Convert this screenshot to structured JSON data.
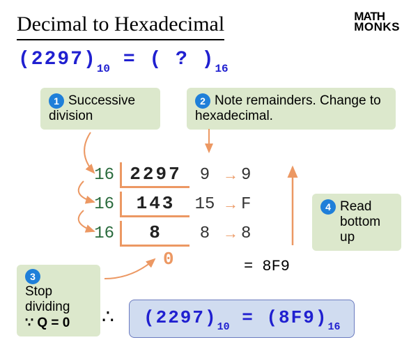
{
  "logo": {
    "line1": "MATH",
    "line2": "MONKS"
  },
  "title": "Decimal to Hexadecimal",
  "eq": {
    "lhs": "(2297)",
    "lbase": "10",
    "mid": " = (   ?   )",
    "rbase": "16"
  },
  "steps": {
    "s1": {
      "num": "1",
      "text": "Successive division"
    },
    "s2": {
      "num": "2",
      "text": "Note remainders. Change to hexadecimal."
    },
    "s3": {
      "num": "3",
      "line1": "Stop",
      "line2": "dividing",
      "line3q": "∵ Q = 0"
    },
    "s4": {
      "num": "4",
      "line1": "Read",
      "line2": "bottom up"
    }
  },
  "division": {
    "base": "16",
    "rows": [
      {
        "dividend": "2297",
        "rem": "9",
        "hex": "9"
      },
      {
        "dividend": "143",
        "rem": "15",
        "hex": "F"
      },
      {
        "dividend": "8",
        "rem": "8",
        "hex": "8"
      }
    ],
    "zero": "0"
  },
  "result_small": "= 8F9",
  "final": {
    "therefore": "∴",
    "lhs": "(2297)",
    "lbase": "10",
    "mid": " = (8F9)",
    "rbase": "16"
  }
}
